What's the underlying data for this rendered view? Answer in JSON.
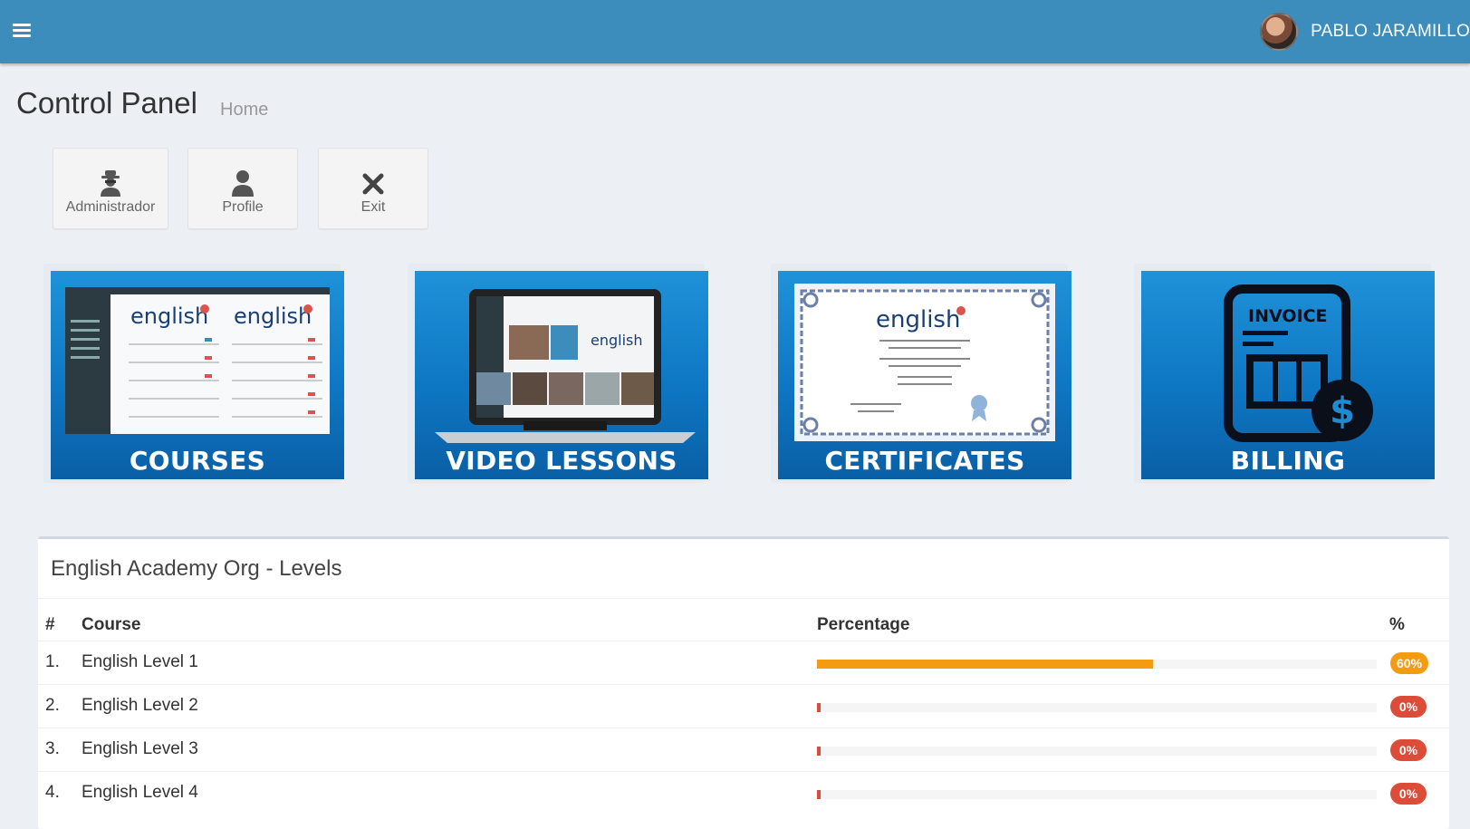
{
  "header": {
    "user_name": "PABLO JARAMILLO",
    "icons": {
      "menu": "hamburger-icon",
      "avatar": "user-avatar"
    }
  },
  "page": {
    "title": "Control Panel",
    "breadcrumb": "Home"
  },
  "quick_buttons": [
    {
      "label": "Administrador",
      "icon": "user-secret-icon"
    },
    {
      "label": "Profile",
      "icon": "user-icon"
    },
    {
      "label": "Exit",
      "icon": "close-icon"
    }
  ],
  "tiles": [
    {
      "label": "COURSES",
      "image": "courses-screenshot"
    },
    {
      "label": "VIDEO LESSONS",
      "image": "laptop-video-call"
    },
    {
      "label": "CERTIFICATES",
      "image": "certificate"
    },
    {
      "label": "BILLING",
      "image": "invoice-dollar-icon"
    }
  ],
  "tile_artwork_text": {
    "brand": "english",
    "invoice": "INVOICE"
  },
  "levels_panel": {
    "title": "English Academy Org - Levels",
    "columns": {
      "num": "#",
      "course": "Course",
      "percentage": "Percentage",
      "pct": "%"
    },
    "rows": [
      {
        "num": "1.",
        "course": "English Level 1",
        "percent": 60,
        "badge": "60%",
        "color": "#f39c12"
      },
      {
        "num": "2.",
        "course": "English Level 2",
        "percent": 0,
        "badge": "0%",
        "color": "#dd4b39"
      },
      {
        "num": "3.",
        "course": "English Level 3",
        "percent": 0,
        "badge": "0%",
        "color": "#dd4b39"
      },
      {
        "num": "4.",
        "course": "English Level 4",
        "percent": 0,
        "badge": "0%",
        "color": "#dd4b39"
      }
    ]
  },
  "colors": {
    "topbar": "#3c8dbc",
    "tile_blue": "#0e77c4",
    "warning": "#f39c12",
    "danger": "#dd4b39"
  }
}
